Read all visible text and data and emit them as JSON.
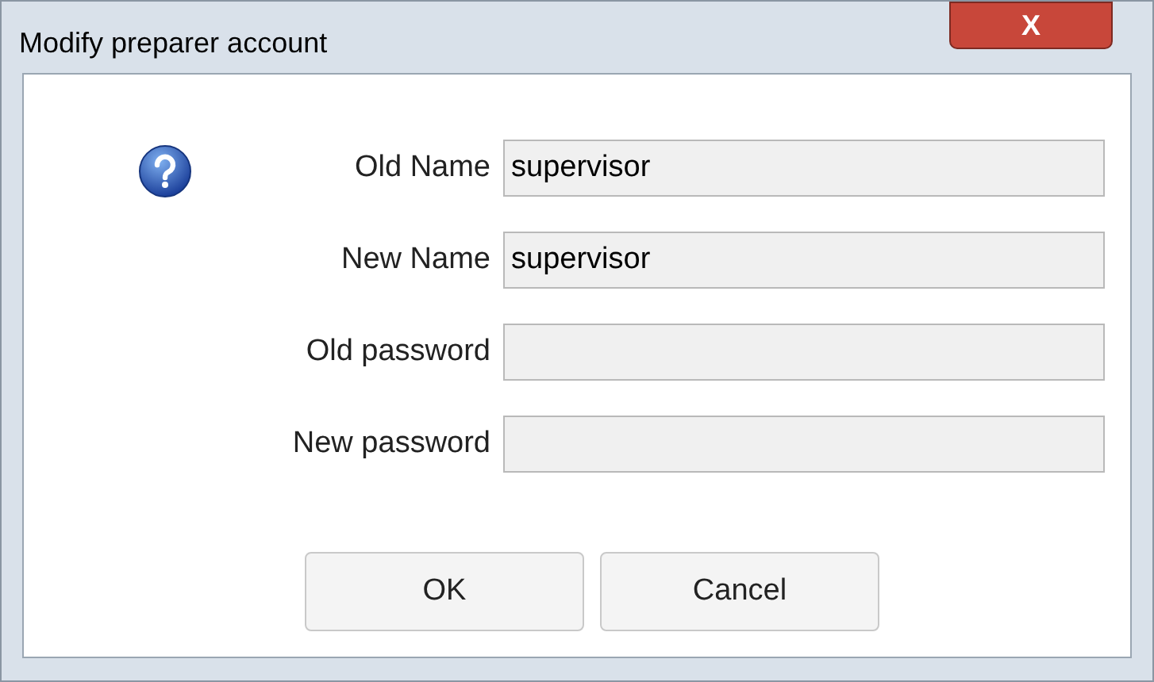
{
  "window": {
    "title": "Modify preparer account",
    "close": "X"
  },
  "fields": [
    {
      "label": "Old Name",
      "value": "supervisor"
    },
    {
      "label": "New Name",
      "value": "supervisor"
    },
    {
      "label": "Old password"
    },
    {
      "label": "New password"
    }
  ],
  "buttons": [
    "OK",
    "Cancel"
  ]
}
